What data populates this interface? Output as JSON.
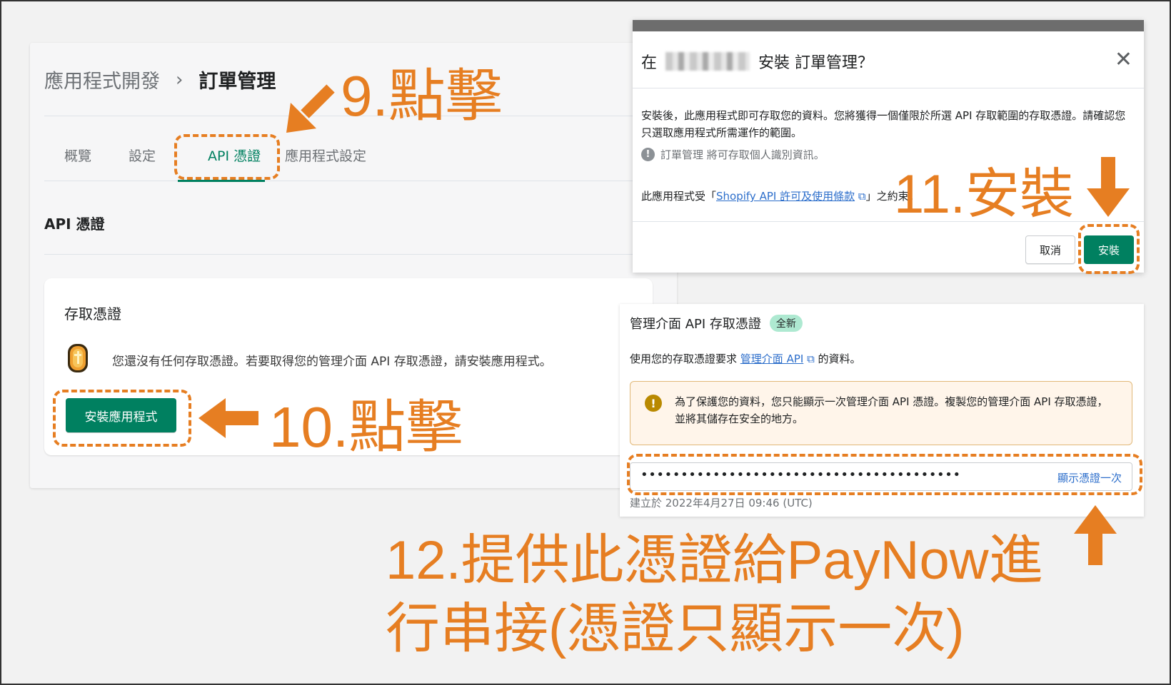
{
  "left_panel": {
    "breadcrumb_parent": "應用程式開發",
    "breadcrumb_sep": "›",
    "breadcrumb_current": "訂單管理",
    "tabs": [
      "概覽",
      "設定",
      "API 憑證",
      "應用程式設定"
    ],
    "active_tab": "API 憑證",
    "section_title": "API 憑證",
    "card_title": "存取憑證",
    "card_text": "您還沒有任何存取憑證。若要取得您的管理介面 API 存取憑證，請安裝應用程式。",
    "install_app_button": "安裝應用程式"
  },
  "dialog": {
    "title_prefix": "在",
    "title_suffix": "安裝 訂單管理？",
    "close": "✕",
    "body": "安裝後，此應用程式即可存取您的資料。您將獲得一個僅限於所選 API 存取範圍的存取憑證。請確認您只選取應用程式所需運作的範圍。",
    "note": "訂單管理 將可存取個人識別資訊。",
    "terms_prefix": "此應用程式受「",
    "terms_link": "Shopify API 許可及使用條款",
    "terms_suffix": "」之約束。",
    "cancel_button": "取消",
    "install_button": "安裝"
  },
  "credentials": {
    "title": "管理介面 API 存取憑證",
    "badge": "全新",
    "desc_prefix": "使用您的存取憑證要求",
    "desc_link": "管理介面 API",
    "desc_suffix": "的資料。",
    "warning": "為了保護您的資料，您只能顯示一次管理介面 API 憑證。複製您的管理介面 API 存取憑證，並將其儲存在安全的地方。",
    "token_masked": "••••••••••••••••••••••••••••••••••••••••",
    "reveal_link": "顯示憑證一次",
    "created": "建立於 2022年4月27日 09:46 (UTC)"
  },
  "annotations": {
    "step9": "9.點擊",
    "step10": "10.點擊",
    "step11": "11.安裝",
    "step12_line1": "12.提供此憑證給PayNow進",
    "step12_line2": "行串接(憑證只顯示一次)"
  },
  "colors": {
    "accent": "#e67e22",
    "primary_button": "#008060",
    "link": "#2c6ecb"
  }
}
